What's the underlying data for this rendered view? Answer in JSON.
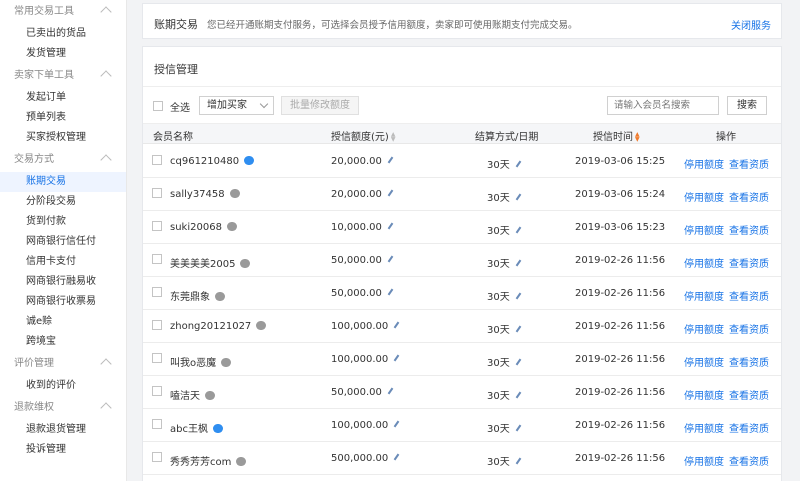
{
  "sidebar": {
    "groups": [
      {
        "title": "常用交易工具",
        "items": [
          "已卖出的货品",
          "发货管理"
        ]
      },
      {
        "title": "卖家下单工具",
        "items": [
          "发起订单",
          "预单列表",
          "买家授权管理"
        ]
      },
      {
        "title": "交易方式",
        "items": [
          "账期交易",
          "分阶段交易",
          "货到付款",
          "网商银行信任付",
          "信用卡支付",
          "网商银行融易收",
          "网商银行收票易",
          "诚e赊",
          "跨境宝"
        ]
      },
      {
        "title": "评价管理",
        "items": [
          "收到的评价"
        ]
      },
      {
        "title": "退款维权",
        "items": [
          "退款退货管理",
          "投诉管理"
        ]
      }
    ],
    "active": "账期交易"
  },
  "notice": {
    "title": "账期交易",
    "desc": "您已经开通账期支付服务，可选择会员授予信用额度，卖家即可使用账期支付完成交易。",
    "close": "关闭服务"
  },
  "panel": {
    "title": "授信管理",
    "toolbar": {
      "select_all": "全选",
      "add_select": "增加买家",
      "batch_button": "批量修改额度",
      "search_placeholder": "请输入会员名搜索",
      "search_button": "搜索"
    },
    "columns": {
      "name": "会员名称",
      "amount": "授信额度(元)",
      "term": "结算方式/日期",
      "time": "授信时间",
      "ops": "操作"
    },
    "rows": [
      {
        "name": "cq961210480",
        "badge": "blue",
        "amount": "20,000.00",
        "term": "30天",
        "time": "2019-03-06 15:25",
        "op1": "停用额度",
        "op2": "查看资质"
      },
      {
        "name": "sally37458",
        "badge": "gray",
        "amount": "20,000.00",
        "term": "30天",
        "time": "2019-03-06 15:24",
        "op1": "停用额度",
        "op2": "查看资质"
      },
      {
        "name": "suki20068",
        "badge": "gray",
        "amount": "10,000.00",
        "term": "30天",
        "time": "2019-03-06 15:23",
        "op1": "停用额度",
        "op2": "查看资质"
      },
      {
        "name": "美美美美2005",
        "badge": "gray",
        "amount": "50,000.00",
        "term": "30天",
        "time": "2019-02-26 11:56",
        "op1": "停用额度",
        "op2": "查看资质"
      },
      {
        "name": "东莞鼎象",
        "badge": "gray",
        "amount": "50,000.00",
        "term": "30天",
        "time": "2019-02-26 11:56",
        "op1": "停用额度",
        "op2": "查看资质"
      },
      {
        "name": "zhong20121027",
        "badge": "gray",
        "amount": "100,000.00",
        "term": "30天",
        "time": "2019-02-26 11:56",
        "op1": "停用额度",
        "op2": "查看资质"
      },
      {
        "name": "叫我o恶魔",
        "badge": "gray",
        "amount": "100,000.00",
        "term": "30天",
        "time": "2019-02-26 11:56",
        "op1": "停用额度",
        "op2": "查看资质"
      },
      {
        "name": "嗑洁天",
        "badge": "gray",
        "amount": "50,000.00",
        "term": "30天",
        "time": "2019-02-26 11:56",
        "op1": "停用额度",
        "op2": "查看资质"
      },
      {
        "name": "abc王枫",
        "badge": "blue",
        "amount": "100,000.00",
        "term": "30天",
        "time": "2019-02-26 11:56",
        "op1": "停用额度",
        "op2": "查看资质"
      },
      {
        "name": "秀秀芳芳com",
        "badge": "gray",
        "amount": "500,000.00",
        "term": "30天",
        "time": "2019-02-26 11:56",
        "op1": "停用额度",
        "op2": "查看资质"
      }
    ]
  },
  "colors": {
    "accent": "#1672e6",
    "sort_active": "#f07a2c",
    "badge_blue": "#2f8ef0",
    "badge_gray": "#9a9a9a"
  }
}
